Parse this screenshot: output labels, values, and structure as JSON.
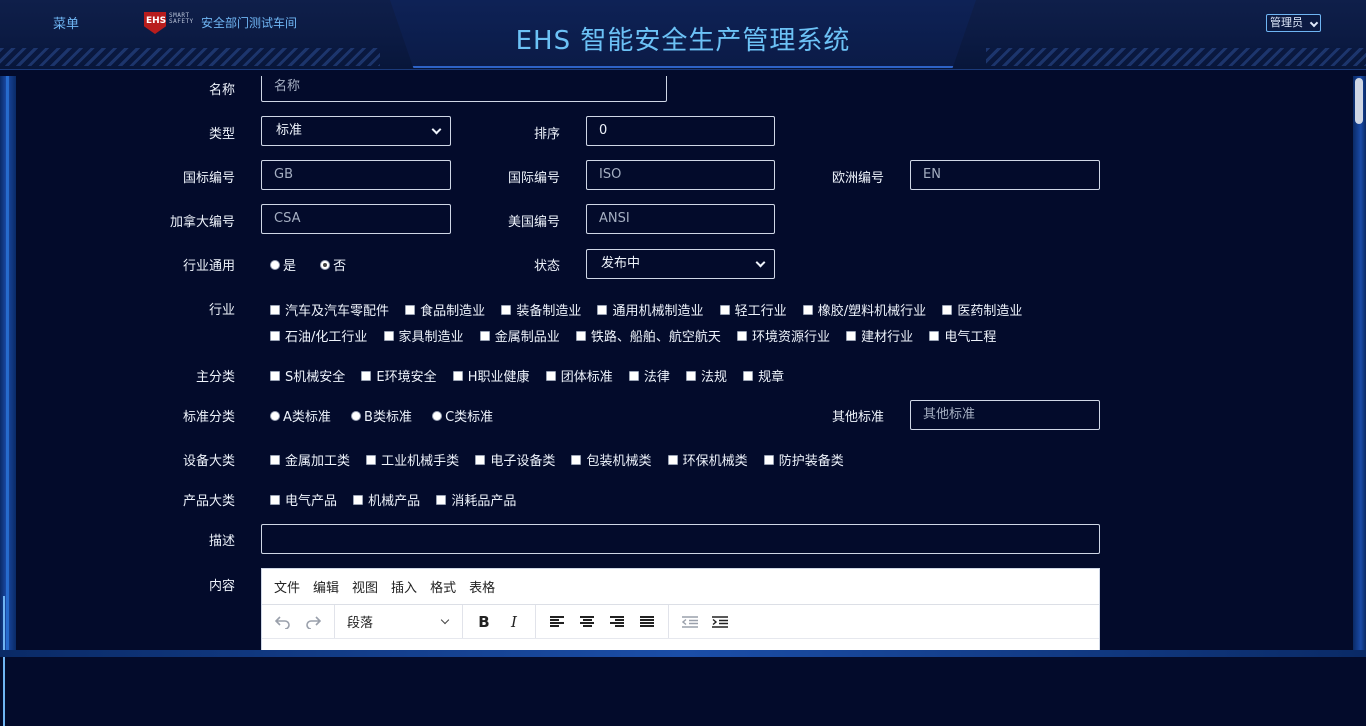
{
  "header": {
    "menu_label": "菜单",
    "logo_text": "EHS",
    "logo_tagline": "SMART SAFETY",
    "workshop": "安全部门测试车间",
    "app_title": "EHS 智能安全生产管理系统",
    "user_role": "管理员"
  },
  "form": {
    "name": {
      "label": "名称",
      "placeholder": "名称",
      "value": ""
    },
    "type": {
      "label": "类型",
      "value": "标准"
    },
    "order": {
      "label": "排序",
      "value": "0"
    },
    "intl_code": {
      "label": "国标编号",
      "placeholder": "GB"
    },
    "iso_code": {
      "label": "国际编号",
      "placeholder": "ISO"
    },
    "eu_code": {
      "label": "欧洲编号",
      "placeholder": "EN"
    },
    "ca_code": {
      "label": "加拿大编号",
      "placeholder": "CSA"
    },
    "us_code": {
      "label": "美国编号",
      "placeholder": "ANSI"
    },
    "industry_general": {
      "label": "行业通用",
      "options": [
        "是",
        "否"
      ],
      "selected": "否"
    },
    "status": {
      "label": "状态",
      "value": "发布中"
    },
    "industry": {
      "label": "行业",
      "row1": [
        "汽车及汽车零配件",
        "食品制造业",
        "装备制造业",
        "通用机械制造业",
        "轻工行业",
        "橡胶/塑料机械行业",
        "医药制造业"
      ],
      "row2": [
        "石油/化工行业",
        "家具制造业",
        "金属制品业",
        "铁路、船舶、航空航天",
        "环境资源行业",
        "建材行业",
        "电气工程"
      ]
    },
    "main_category": {
      "label": "主分类",
      "options": [
        "S机械安全",
        "E环境安全",
        "H职业健康",
        "团体标准",
        "法律",
        "法规",
        "规章"
      ]
    },
    "std_category": {
      "label": "标准分类",
      "options": [
        "A类标准",
        "B类标准",
        "C类标准"
      ]
    },
    "other_std": {
      "label": "其他标准",
      "placeholder": "其他标准"
    },
    "equipment": {
      "label": "设备大类",
      "options": [
        "金属加工类",
        "工业机械手类",
        "电子设备类",
        "包装机械类",
        "环保机械类",
        "防护装备类"
      ]
    },
    "product": {
      "label": "产品大类",
      "options": [
        "电气产品",
        "机械产品",
        "消耗品产品"
      ]
    },
    "description": {
      "label": "描述",
      "value": ""
    },
    "content": {
      "label": "内容"
    }
  },
  "editor": {
    "menu": [
      "文件",
      "编辑",
      "视图",
      "插入",
      "格式",
      "表格"
    ],
    "block_format": "段落"
  }
}
